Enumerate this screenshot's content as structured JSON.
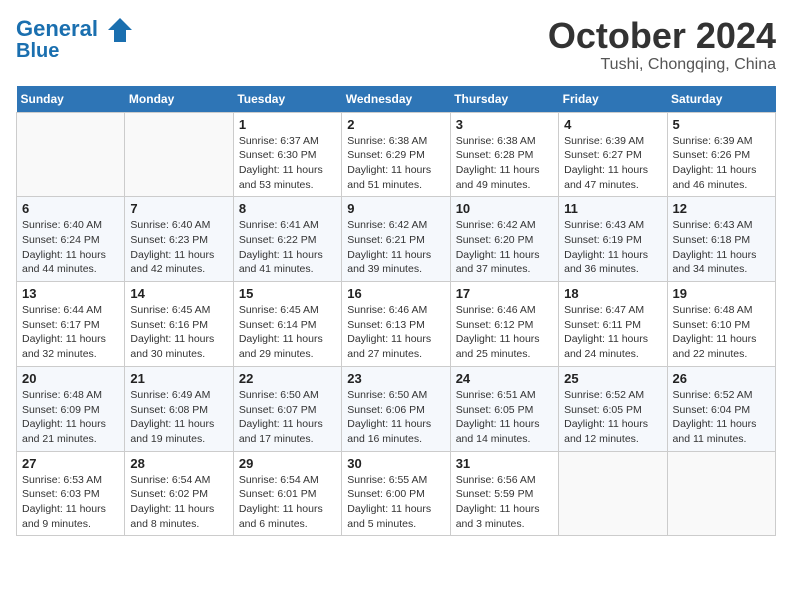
{
  "header": {
    "logo_line1": "General",
    "logo_line2": "Blue",
    "month": "October 2024",
    "location": "Tushi, Chongqing, China"
  },
  "days_of_week": [
    "Sunday",
    "Monday",
    "Tuesday",
    "Wednesday",
    "Thursday",
    "Friday",
    "Saturday"
  ],
  "weeks": [
    [
      {
        "num": "",
        "info": ""
      },
      {
        "num": "",
        "info": ""
      },
      {
        "num": "1",
        "info": "Sunrise: 6:37 AM\nSunset: 6:30 PM\nDaylight: 11 hours and 53 minutes."
      },
      {
        "num": "2",
        "info": "Sunrise: 6:38 AM\nSunset: 6:29 PM\nDaylight: 11 hours and 51 minutes."
      },
      {
        "num": "3",
        "info": "Sunrise: 6:38 AM\nSunset: 6:28 PM\nDaylight: 11 hours and 49 minutes."
      },
      {
        "num": "4",
        "info": "Sunrise: 6:39 AM\nSunset: 6:27 PM\nDaylight: 11 hours and 47 minutes."
      },
      {
        "num": "5",
        "info": "Sunrise: 6:39 AM\nSunset: 6:26 PM\nDaylight: 11 hours and 46 minutes."
      }
    ],
    [
      {
        "num": "6",
        "info": "Sunrise: 6:40 AM\nSunset: 6:24 PM\nDaylight: 11 hours and 44 minutes."
      },
      {
        "num": "7",
        "info": "Sunrise: 6:40 AM\nSunset: 6:23 PM\nDaylight: 11 hours and 42 minutes."
      },
      {
        "num": "8",
        "info": "Sunrise: 6:41 AM\nSunset: 6:22 PM\nDaylight: 11 hours and 41 minutes."
      },
      {
        "num": "9",
        "info": "Sunrise: 6:42 AM\nSunset: 6:21 PM\nDaylight: 11 hours and 39 minutes."
      },
      {
        "num": "10",
        "info": "Sunrise: 6:42 AM\nSunset: 6:20 PM\nDaylight: 11 hours and 37 minutes."
      },
      {
        "num": "11",
        "info": "Sunrise: 6:43 AM\nSunset: 6:19 PM\nDaylight: 11 hours and 36 minutes."
      },
      {
        "num": "12",
        "info": "Sunrise: 6:43 AM\nSunset: 6:18 PM\nDaylight: 11 hours and 34 minutes."
      }
    ],
    [
      {
        "num": "13",
        "info": "Sunrise: 6:44 AM\nSunset: 6:17 PM\nDaylight: 11 hours and 32 minutes."
      },
      {
        "num": "14",
        "info": "Sunrise: 6:45 AM\nSunset: 6:16 PM\nDaylight: 11 hours and 30 minutes."
      },
      {
        "num": "15",
        "info": "Sunrise: 6:45 AM\nSunset: 6:14 PM\nDaylight: 11 hours and 29 minutes."
      },
      {
        "num": "16",
        "info": "Sunrise: 6:46 AM\nSunset: 6:13 PM\nDaylight: 11 hours and 27 minutes."
      },
      {
        "num": "17",
        "info": "Sunrise: 6:46 AM\nSunset: 6:12 PM\nDaylight: 11 hours and 25 minutes."
      },
      {
        "num": "18",
        "info": "Sunrise: 6:47 AM\nSunset: 6:11 PM\nDaylight: 11 hours and 24 minutes."
      },
      {
        "num": "19",
        "info": "Sunrise: 6:48 AM\nSunset: 6:10 PM\nDaylight: 11 hours and 22 minutes."
      }
    ],
    [
      {
        "num": "20",
        "info": "Sunrise: 6:48 AM\nSunset: 6:09 PM\nDaylight: 11 hours and 21 minutes."
      },
      {
        "num": "21",
        "info": "Sunrise: 6:49 AM\nSunset: 6:08 PM\nDaylight: 11 hours and 19 minutes."
      },
      {
        "num": "22",
        "info": "Sunrise: 6:50 AM\nSunset: 6:07 PM\nDaylight: 11 hours and 17 minutes."
      },
      {
        "num": "23",
        "info": "Sunrise: 6:50 AM\nSunset: 6:06 PM\nDaylight: 11 hours and 16 minutes."
      },
      {
        "num": "24",
        "info": "Sunrise: 6:51 AM\nSunset: 6:05 PM\nDaylight: 11 hours and 14 minutes."
      },
      {
        "num": "25",
        "info": "Sunrise: 6:52 AM\nSunset: 6:05 PM\nDaylight: 11 hours and 12 minutes."
      },
      {
        "num": "26",
        "info": "Sunrise: 6:52 AM\nSunset: 6:04 PM\nDaylight: 11 hours and 11 minutes."
      }
    ],
    [
      {
        "num": "27",
        "info": "Sunrise: 6:53 AM\nSunset: 6:03 PM\nDaylight: 11 hours and 9 minutes."
      },
      {
        "num": "28",
        "info": "Sunrise: 6:54 AM\nSunset: 6:02 PM\nDaylight: 11 hours and 8 minutes."
      },
      {
        "num": "29",
        "info": "Sunrise: 6:54 AM\nSunset: 6:01 PM\nDaylight: 11 hours and 6 minutes."
      },
      {
        "num": "30",
        "info": "Sunrise: 6:55 AM\nSunset: 6:00 PM\nDaylight: 11 hours and 5 minutes."
      },
      {
        "num": "31",
        "info": "Sunrise: 6:56 AM\nSunset: 5:59 PM\nDaylight: 11 hours and 3 minutes."
      },
      {
        "num": "",
        "info": ""
      },
      {
        "num": "",
        "info": ""
      }
    ]
  ]
}
